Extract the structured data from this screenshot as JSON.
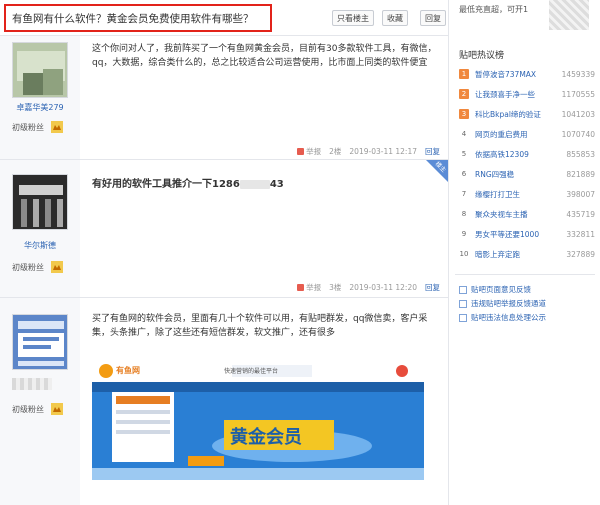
{
  "header": {
    "title": "有鱼网有什么软件？黄金会员免费使用软件有哪些？",
    "btn_owner_only": "只看楼主",
    "btn_favorite": "收藏",
    "btn_reply": "回复"
  },
  "posts": [
    {
      "username": "卓嘉华美279",
      "level": "初级粉丝",
      "content": "这个你问对人了，我前阵买了一个有鱼网黄金会员，目前有30多款软件工具，有微信，qq，大数据，综合类什么的，总之比较适合公司运营使用，比市面上同类的软件便宜",
      "report": "举报",
      "floor": "2楼",
      "time": "2019-03-11 12:17",
      "reply": "回复"
    },
    {
      "username": "华尔斯德",
      "level": "初级粉丝",
      "content": "有好用的软件工具推介一下1286",
      "content_tail": "43",
      "report": "举报",
      "floor": "3楼",
      "time": "2019-03-11 12:20",
      "reply": "回复",
      "badge": "楼主"
    },
    {
      "level": "初级粉丝",
      "content": "买了有鱼网的软件会员，里面有几十个软件可以用，有贴吧群发，qq微信卖，客户采集，头条推广，除了这些还有短信群发，软文推广，还有很多",
      "promo_logo": "有鱼网",
      "promo_tagline": "快速营销的最佳平台",
      "promo_main": "黄金会员"
    }
  ],
  "sidebar": {
    "top_text": "最低充直超，可开1",
    "heading": "贴吧热议榜",
    "hot": [
      {
        "rank": "1",
        "title": "暂停波音737MAX",
        "count": "1459339",
        "top": true
      },
      {
        "rank": "2",
        "title": "让我颈喜手净一些",
        "count": "1170555",
        "top": true
      },
      {
        "rank": "3",
        "title": "科比Bkpal缔的验证",
        "count": "1041203",
        "top": true
      },
      {
        "rank": "4",
        "title": "网页的重启费用",
        "count": "1070740",
        "top": false
      },
      {
        "rank": "5",
        "title": "依据高铁12309",
        "count": "855853",
        "top": false
      },
      {
        "rank": "6",
        "title": "RNG四强稳",
        "count": "821889",
        "top": false
      },
      {
        "rank": "7",
        "title": "缘樱打打卫生",
        "count": "398007",
        "top": false
      },
      {
        "rank": "8",
        "title": "聚众夹视车主播",
        "count": "435719",
        "top": false
      },
      {
        "rank": "9",
        "title": "男女平等还要1000",
        "count": "332811",
        "top": false
      },
      {
        "rank": "10",
        "title": "暗影上弃定跑",
        "count": "327889",
        "top": false
      }
    ],
    "links": [
      "贴吧页面意见反馈",
      "违规贴吧举报反馈通道",
      "贴吧违法信息处理公示"
    ]
  }
}
